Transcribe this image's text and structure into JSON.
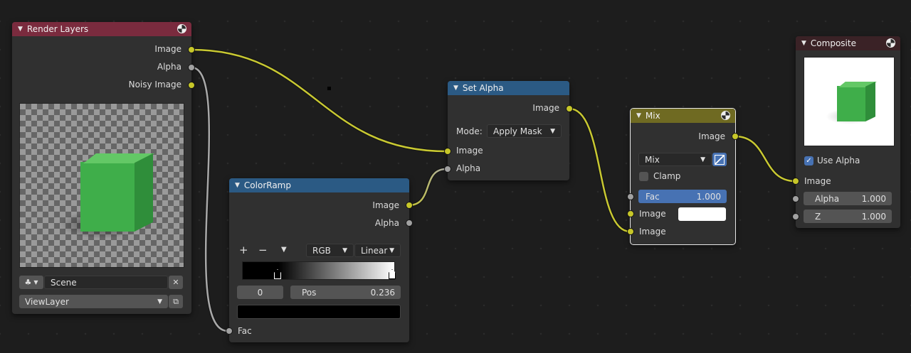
{
  "colors": {
    "render_layers_header": "#7a2b3e",
    "converter_header": "#2b5a84",
    "mix_header": "#6f6a22",
    "composite_header": "#3a2226",
    "image_socket": "#c7c729",
    "float_socket": "#a1a1a1",
    "fac_field": "#4772b3",
    "link": "#c8c832"
  },
  "render_layers": {
    "title": "Render Layers",
    "outputs": [
      "Image",
      "Alpha",
      "Noisy Image"
    ],
    "scene_icon": "scene-icon",
    "scene_value": "Scene",
    "view_layer_value": "ViewLayer"
  },
  "color_ramp": {
    "title": "ColorRamp",
    "outputs": [
      "Image",
      "Alpha"
    ],
    "add": "+",
    "remove": "−",
    "color_mode": "RGB",
    "interpolation": "Linear",
    "stop_index": "0",
    "pos_label": "Pos",
    "pos_value": "0.236",
    "input": "Fac"
  },
  "set_alpha": {
    "title": "Set Alpha",
    "output": "Image",
    "mode_label": "Mode:",
    "mode_value": "Apply Mask",
    "inputs": [
      "Image",
      "Alpha"
    ]
  },
  "mix": {
    "title": "Mix",
    "output": "Image",
    "blend_mode": "Mix",
    "clamp_label": "Clamp",
    "clamp_checked": false,
    "fac_label": "Fac",
    "fac_value": "1.000",
    "inputs": [
      "Image",
      "Image"
    ],
    "image_color": "#ffffff"
  },
  "composite": {
    "title": "Composite",
    "use_alpha_label": "Use Alpha",
    "use_alpha_checked": true,
    "input": "Image",
    "alpha_label": "Alpha",
    "alpha_value": "1.000",
    "z_label": "Z",
    "z_value": "1.000"
  }
}
